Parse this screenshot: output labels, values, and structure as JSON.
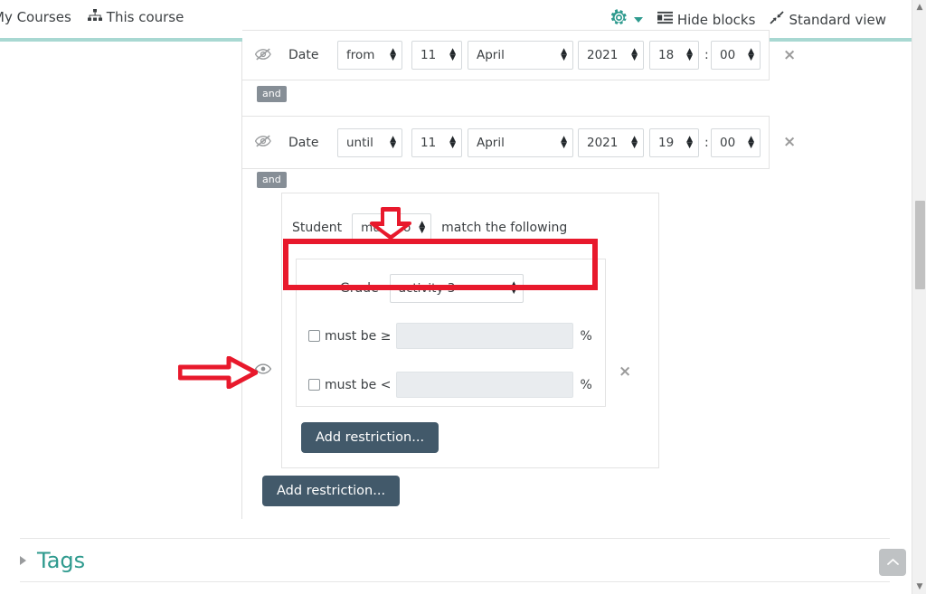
{
  "topnav": {
    "left_items": [
      {
        "label": "My Courses",
        "icon": ""
      },
      {
        "label": "This course",
        "icon": "sitemap-icon"
      }
    ],
    "gear_icon": "gear-icon",
    "hide_blocks": "Hide blocks",
    "standard_view": "Standard view",
    "teal": "#a8d8d2",
    "accent": "#2e9a8e"
  },
  "restrictions": {
    "operator": "and",
    "rows": [
      {
        "label": "Date",
        "eye": "eye-slash-icon",
        "direction": {
          "value": "from",
          "options": [
            "from",
            "until"
          ]
        },
        "day": {
          "value": "11"
        },
        "month": {
          "value": "April"
        },
        "year": {
          "value": "2021"
        },
        "hour": {
          "value": "18"
        },
        "minute": {
          "value": "00"
        },
        "separator": ":",
        "delete": "×"
      },
      {
        "label": "Date",
        "eye": "eye-slash-icon",
        "direction": {
          "value": "until",
          "options": [
            "from",
            "until"
          ]
        },
        "day": {
          "value": "11"
        },
        "month": {
          "value": "April"
        },
        "year": {
          "value": "2021"
        },
        "hour": {
          "value": "19"
        },
        "minute": {
          "value": "00"
        },
        "separator": ":",
        "delete": "×"
      }
    ],
    "nested_set": {
      "eye": "eye-icon",
      "delete": "×",
      "student_label": "Student",
      "match_select": {
        "value": "must not",
        "options": [
          "must",
          "must not"
        ]
      },
      "match_suffix": "match the following",
      "grade": {
        "label": "Grade",
        "select": {
          "value": "activity 3",
          "options": [
            "activity 3"
          ]
        },
        "min": {
          "label": "must be ≥",
          "checked": false,
          "value": "",
          "unit": "%"
        },
        "max": {
          "label": "must be <",
          "checked": false,
          "value": "",
          "unit": "%"
        },
        "delete": "×"
      },
      "add_restriction": "Add restriction..."
    },
    "add_restriction": "Add restriction..."
  },
  "tags": {
    "title": "Tags",
    "collapsed": true,
    "triangle": "triangle-right-icon"
  },
  "back_to_top": {
    "icon": "chevron-up-icon",
    "label": "^"
  },
  "scrollbar": {
    "up_arrow": "▲",
    "down_arrow": "▼"
  },
  "annotations": {
    "highlight_color": "#e8192c",
    "arrow_down": "arrow-down-annotation",
    "arrow_right": "arrow-right-annotation",
    "box": "highlight-box-annotation"
  }
}
